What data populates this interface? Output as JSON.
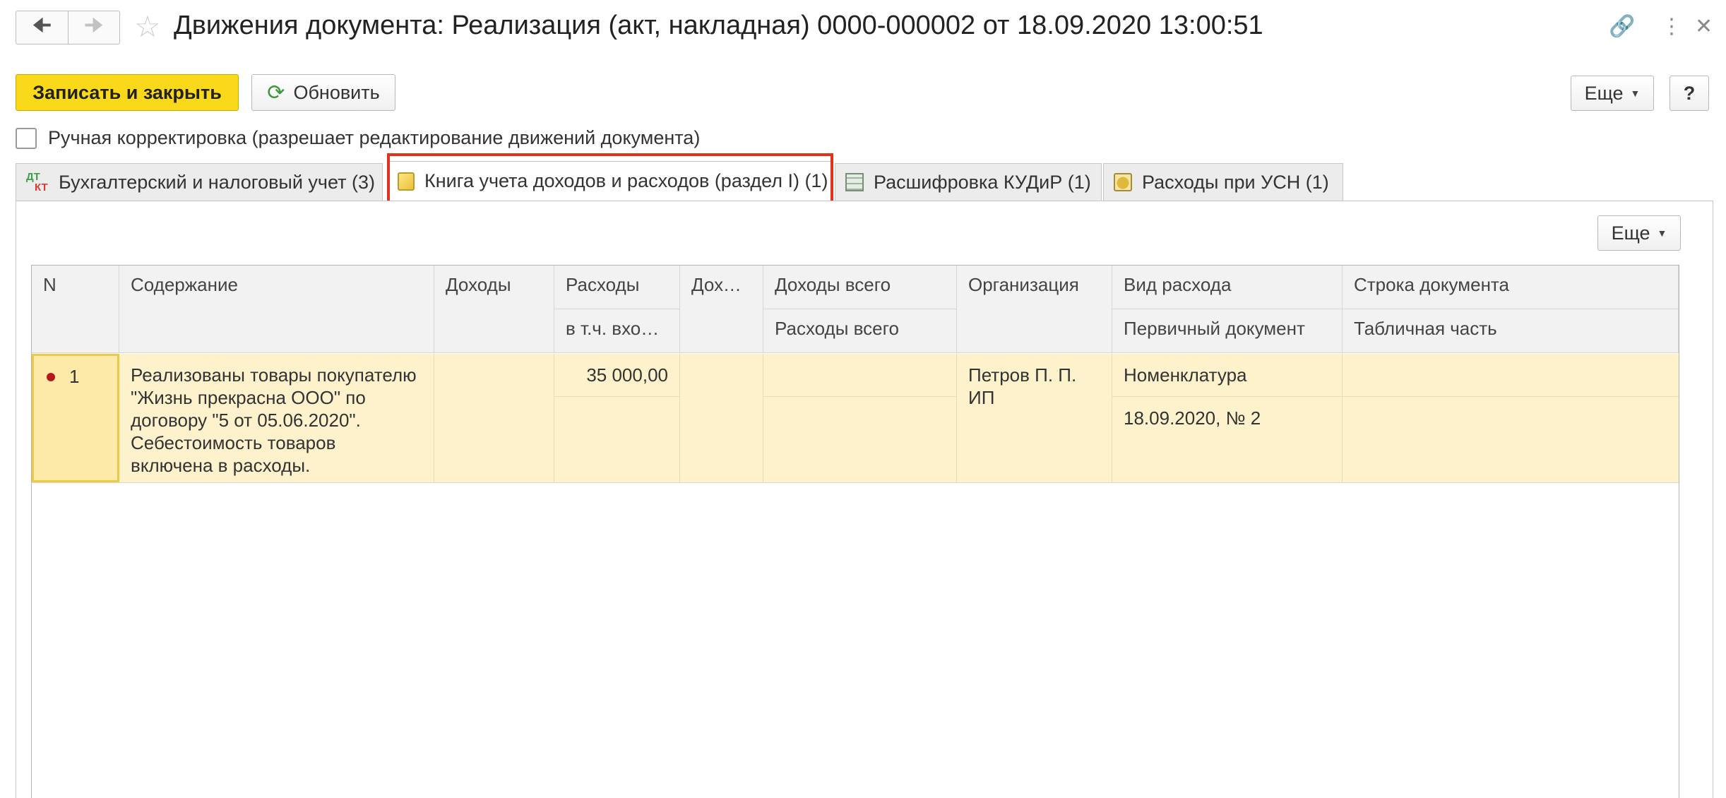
{
  "window": {
    "title": "Движения документа: Реализация (акт, накладная) 0000-000002 от 18.09.2020 13:00:51"
  },
  "toolbar": {
    "save_close_label": "Записать и закрыть",
    "refresh_label": "Обновить",
    "more_label": "Еще",
    "help_label": "?"
  },
  "manual_edit": {
    "label": "Ручная корректировка (разрешает редактирование движений документа)",
    "checked": false
  },
  "tabs": [
    {
      "label": "Бухгалтерский и налоговый учет (3)",
      "icon": "dt-kt-icon",
      "active": false
    },
    {
      "label": "Книга учета доходов и расходов (раздел I) (1)",
      "icon": "book-icon",
      "active": true
    },
    {
      "label": "Расшифровка КУДиР (1)",
      "icon": "table-icon",
      "active": false
    },
    {
      "label": "Расходы при УСН (1)",
      "icon": "coins-icon",
      "active": false
    }
  ],
  "table": {
    "more_label": "Еще",
    "headers": {
      "n": "N",
      "content": "Содержание",
      "income": "Доходы",
      "expenses": "Расходы",
      "expenses_incl": "в т.ч. вхо…",
      "income_trunc": "Дохо…",
      "income_total": "Доходы всего",
      "expenses_total": "Расходы всего",
      "organization": "Организация",
      "expense_type": "Вид расхода",
      "primary_doc": "Первичный документ",
      "doc_line": "Строка документа",
      "table_part": "Табличная часть"
    },
    "rows": [
      {
        "n": "1",
        "content": "Реализованы товары покупателю \"Жизнь прекрасна ООО\" по договору \"5 от 05.06.2020\". Себестоимость товаров включена в расходы.",
        "income": "",
        "expenses": "35 000,00",
        "expenses_incl": "",
        "income_trunc": "",
        "income_total": "",
        "expenses_total": "",
        "organization": "Петров П. П. ИП",
        "expense_type": "Номенклатура",
        "primary_doc": "18.09.2020, № 2",
        "doc_line": "",
        "table_part": ""
      }
    ]
  },
  "colors": {
    "primary_button": "#f9d91a",
    "row_highlight": "#fdf2cc",
    "tab_highlight_border": "#e0331e"
  }
}
